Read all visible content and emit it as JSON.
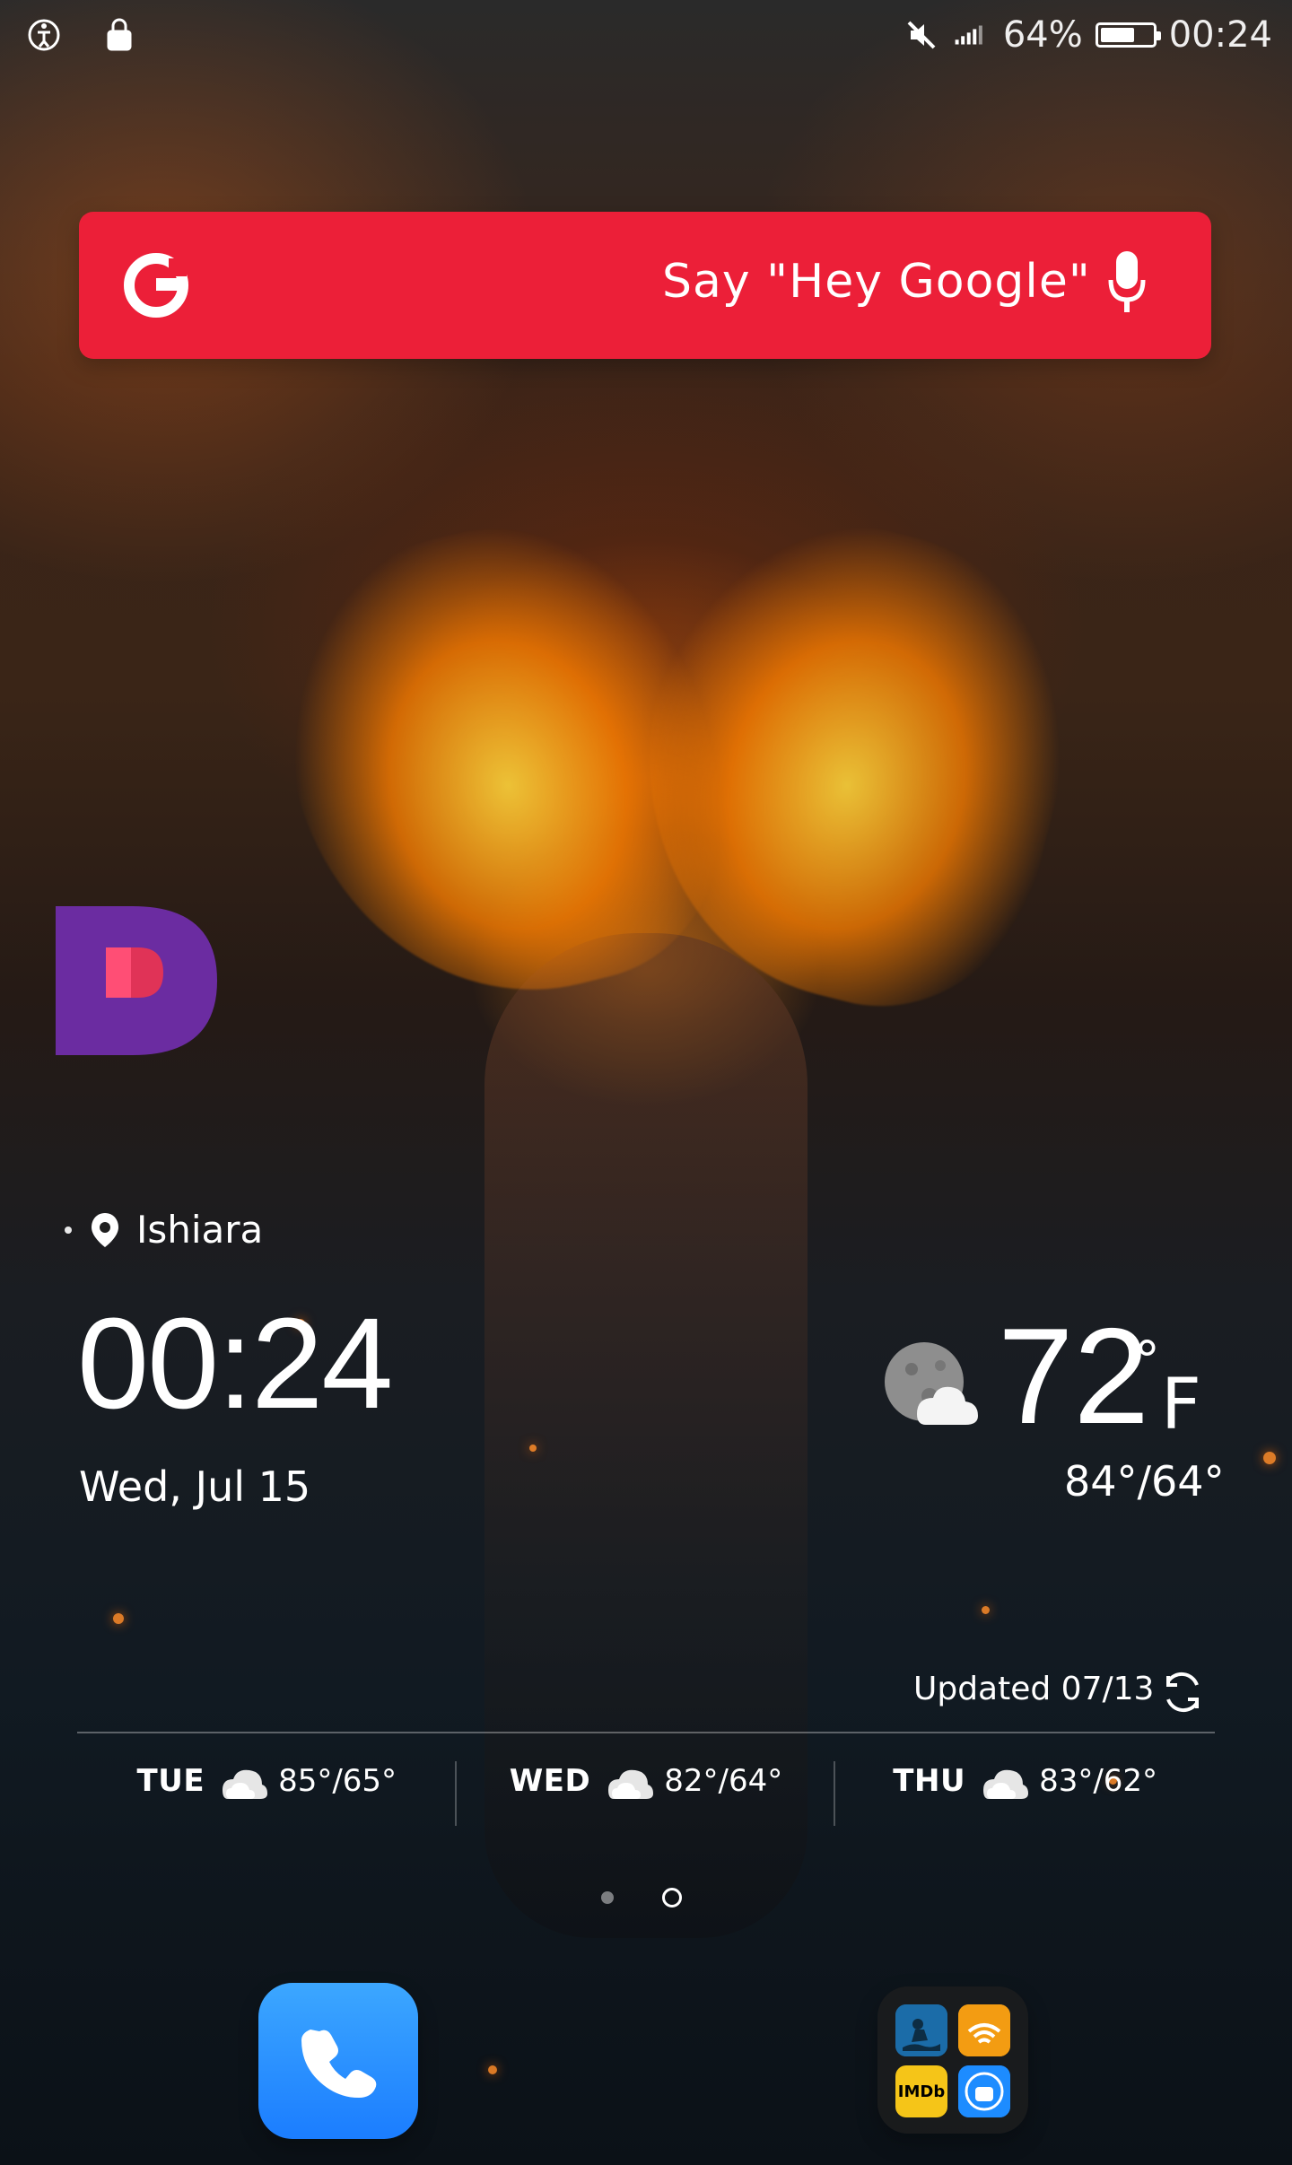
{
  "status_bar": {
    "battery_percent_text": "64%",
    "battery_level": 64,
    "time": "00:24",
    "icons": {
      "accessibility": "accessibility-icon",
      "lock": "lock-icon",
      "mute": "mute-icon",
      "signal": "signal-icon",
      "battery": "battery-icon"
    }
  },
  "search_widget": {
    "brand_icon": "google-g-icon",
    "prompt": "Say \"Hey Google\"",
    "mic_icon": "mic-icon",
    "accent_color": "#ec1f38"
  },
  "badge": {
    "icon": "app-badge-icon"
  },
  "clock_widget": {
    "location": "Ishiara",
    "time": "00:24",
    "date": "Wed, Jul 15"
  },
  "weather_widget": {
    "icon": "moon-cloud-icon",
    "temperature": "72",
    "unit": "°F",
    "range": "84°/64°",
    "updated": "Updated 07/13",
    "refresh_icon": "refresh-icon",
    "forecast": [
      {
        "day": "TUE",
        "icon": "cloudy-icon",
        "range": "85°/65°"
      },
      {
        "day": "WED",
        "icon": "cloudy-icon",
        "range": "82°/64°"
      },
      {
        "day": "THU",
        "icon": "cloudy-icon",
        "range": "83°/62°"
      }
    ]
  },
  "home": {
    "page_indicator": {
      "pages": 2,
      "active_page": 2
    },
    "dock": {
      "phone_icon": "phone-icon",
      "folder_icon": "app-folder-icon",
      "folder_apps": [
        "kindle-icon",
        "audible-icon",
        "imdb-icon",
        "android-icon"
      ],
      "imdb_label": "IMDb"
    }
  }
}
